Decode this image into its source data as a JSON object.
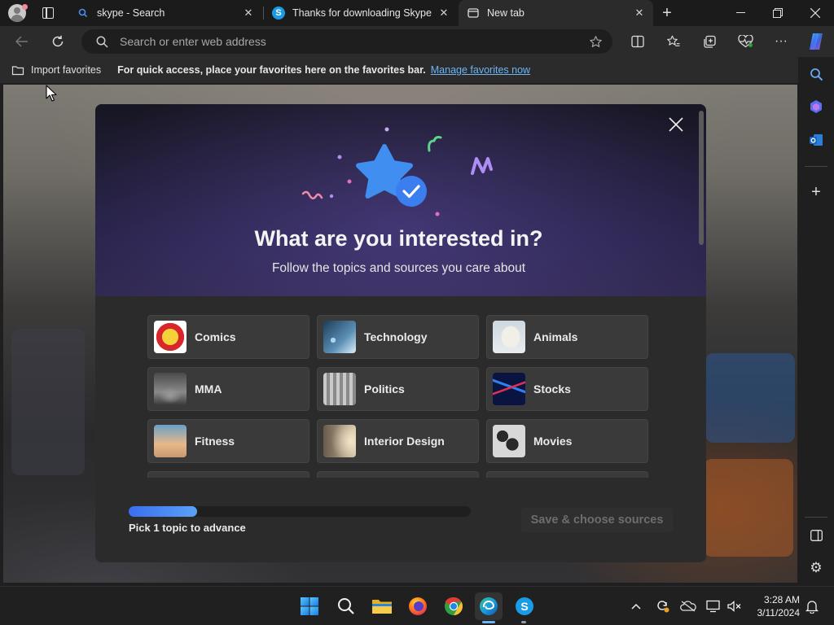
{
  "browser": {
    "tabs": [
      {
        "title": "skype - Search",
        "icon": "search-icon"
      },
      {
        "title": "Thanks for downloading Skype",
        "icon": "skype-icon"
      },
      {
        "title": "New tab",
        "icon": "newtab-icon",
        "active": true
      }
    ],
    "new_tab_symbol": "+",
    "address": {
      "placeholder": "Search or enter web address",
      "value": ""
    },
    "favorites_bar": {
      "import_label": "Import favorites",
      "message": "For quick access, place your favorites here on the favorites bar.",
      "link": "Manage favorites now"
    }
  },
  "modal": {
    "headline": "What are you interested in?",
    "subline": "Follow the topics and sources you care about",
    "topics": [
      {
        "label": "Comics",
        "thumb": "comics"
      },
      {
        "label": "Technology",
        "thumb": "technology"
      },
      {
        "label": "Animals",
        "thumb": "animals"
      },
      {
        "label": "MMA",
        "thumb": "mma"
      },
      {
        "label": "Politics",
        "thumb": "politics"
      },
      {
        "label": "Stocks",
        "thumb": "stocks"
      },
      {
        "label": "Fitness",
        "thumb": "fitness"
      },
      {
        "label": "Interior Design",
        "thumb": "interior"
      },
      {
        "label": "Movies",
        "thumb": "movies"
      }
    ],
    "progress": {
      "fraction": 0.2,
      "label": "Pick 1 topic to advance"
    },
    "save_button": "Save & choose sources"
  },
  "taskbar": {
    "apps": [
      "windows-start",
      "search",
      "file-explorer",
      "firefox",
      "chrome",
      "edge",
      "skype"
    ],
    "time": "3:28 AM",
    "date": "3/11/2024"
  },
  "colors": {
    "accent": "#3b6ef0",
    "link": "#6cb4f5",
    "tile": "#3a3a3a"
  }
}
